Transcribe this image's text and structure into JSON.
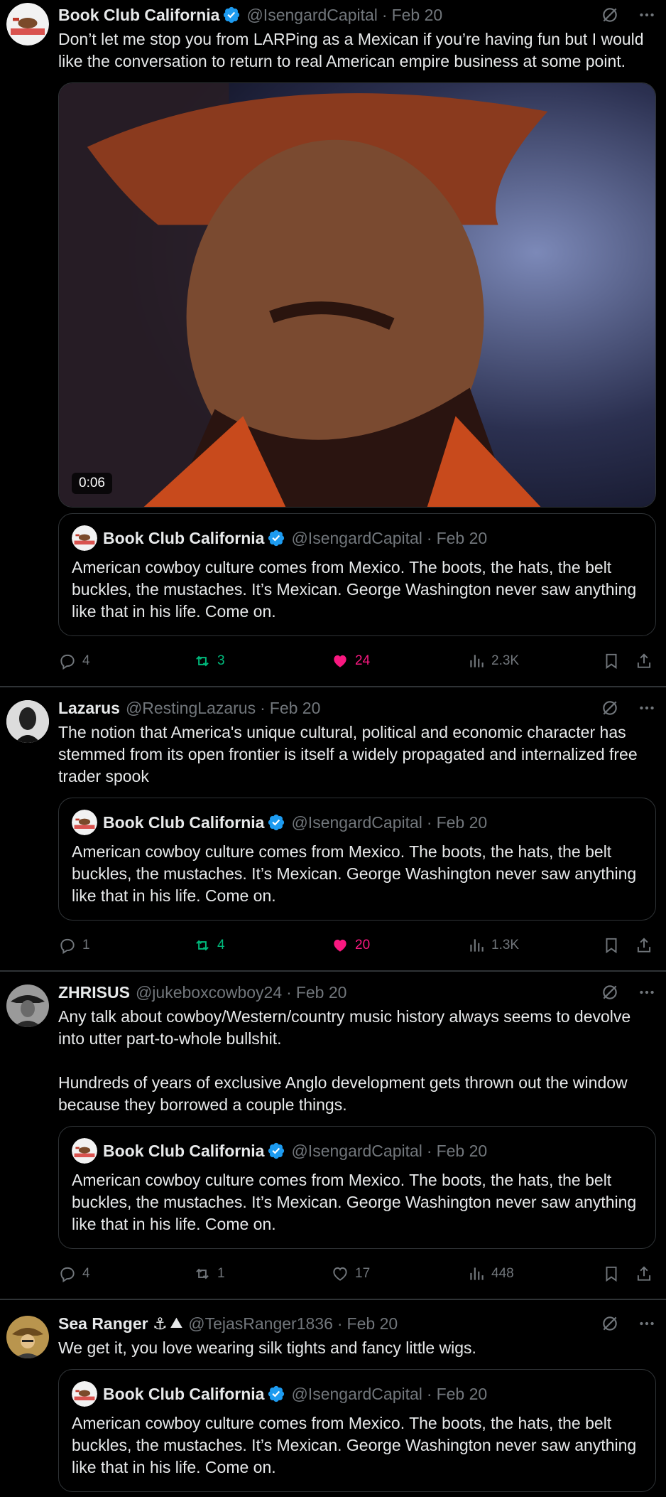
{
  "tweets": [
    {
      "author": "Book Club California",
      "handle": "@IsengardCapital",
      "time": "Feb 20",
      "text": "Don’t let me stop you from LARPing as a Mexican if you’re having fun but I would like the conversation to return to real American empire business at some point.",
      "video_duration": "0:06",
      "quote": {
        "author": "Book Club California",
        "handle": "@IsengardCapital",
        "time": "Feb 20",
        "text": "American cowboy culture comes from Mexico. The boots, the hats, the belt buckles, the mustaches. It’s Mexican. George Washington never saw anything like that in his life. Come on."
      },
      "replies": "4",
      "reposts": "3",
      "likes": "24",
      "views": "2.3K"
    },
    {
      "author": "Lazarus",
      "handle": "@RestingLazarus",
      "time": "Feb 20",
      "text": "The notion that America's unique cultural, political and economic character has stemmed from its open frontier is itself a widely propagated and internalized free trader spook",
      "quote": {
        "author": "Book Club California",
        "handle": "@IsengardCapital",
        "time": "Feb 20",
        "text": "American cowboy culture comes from Mexico. The boots, the hats, the belt buckles, the mustaches. It’s Mexican. George Washington never saw anything like that in his life. Come on."
      },
      "replies": "1",
      "reposts": "4",
      "likes": "20",
      "views": "1.3K"
    },
    {
      "author": "ZHRISUS",
      "handle": "@jukeboxcowboy24",
      "time": "Feb 20",
      "text": "Any talk about cowboy/Western/country music history always seems to devolve into utter part-to-whole bullshit.\n\nHundreds of years of exclusive Anglo development gets thrown out the window because they borrowed a couple things.",
      "quote": {
        "author": "Book Club California",
        "handle": "@IsengardCapital",
        "time": "Feb 20",
        "text": "American cowboy culture comes from Mexico. The boots, the hats, the belt buckles, the mustaches. It’s Mexican. George Washington never saw anything like that in his life. Come on."
      },
      "replies": "4",
      "reposts": "1",
      "likes": "17",
      "views": "448"
    },
    {
      "author": "Sea Ranger ⚓",
      "handle": "@TejasRanger1836",
      "time": "Feb 20",
      "text": "We get it, you love wearing silk tights and fancy little wigs.",
      "quote": {
        "author": "Book Club California",
        "handle": "@IsengardCapital",
        "time": "Feb 20",
        "text": "American cowboy culture comes from Mexico. The boots, the hats, the belt buckles, the mustaches. It’s Mexican. George Washington never saw anything like that in his life. Come on."
      }
    }
  ],
  "colors": {
    "background": "#000000",
    "text": "#e7e9ea",
    "muted": "#71767b",
    "border": "#2f3336",
    "verified": "#1d9bf0",
    "repost_active": "#00ba7c",
    "like_active": "#f91880"
  },
  "icons": [
    "verified-badge-icon",
    "grok-icon",
    "more-icon",
    "reply-icon",
    "repost-icon",
    "like-icon",
    "views-icon",
    "bookmark-icon",
    "share-icon"
  ]
}
